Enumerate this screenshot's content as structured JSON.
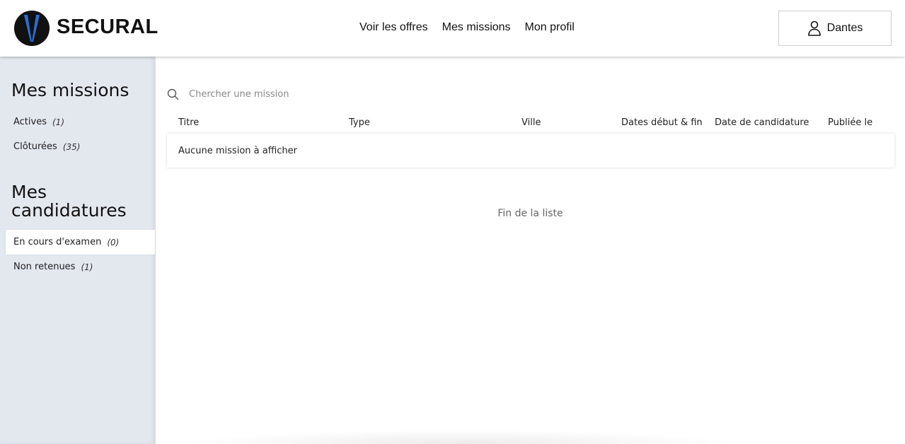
{
  "header": {
    "brand": "SECURAL",
    "nav": [
      "Voir les offres",
      "Mes missions",
      "Mon profil"
    ],
    "user_name": "Dantes"
  },
  "sidebar": {
    "missions_title": "Mes missions",
    "missions": [
      {
        "label": "Actives",
        "count": "(1)"
      },
      {
        "label": "Clôturées",
        "count": "(35)"
      }
    ],
    "applications_title_line1": "Mes",
    "applications_title_line2": "candidatures",
    "applications": [
      {
        "label": "En cours d'examen",
        "count": "(0)",
        "active": true
      },
      {
        "label": "Non retenues",
        "count": "(1)"
      }
    ]
  },
  "main": {
    "search_placeholder": "Chercher une mission",
    "columns": [
      "Titre",
      "Type",
      "Ville",
      "Dates début & fin",
      "Date de candidature",
      "Publiée le"
    ],
    "empty_message": "Aucune mission à afficher",
    "end_of_list": "Fin de la liste"
  },
  "colors": {
    "sidebar_bg": "#e3e8ef",
    "logo_blue": "#2b6fd6",
    "logo_dark": "#111111"
  },
  "icons": {
    "logo": "secural-logo-icon",
    "user": "user-icon",
    "search": "search-icon"
  }
}
